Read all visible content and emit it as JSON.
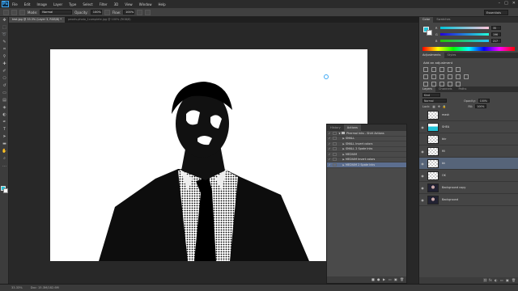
{
  "app": {
    "logo": "Ps"
  },
  "menu": [
    "File",
    "Edit",
    "Image",
    "Layer",
    "Type",
    "Select",
    "Filter",
    "3D",
    "View",
    "Window",
    "Help"
  ],
  "window_controls": [
    "–",
    "□",
    "✕"
  ],
  "options_bar": {
    "mode_label": "Mode:",
    "mode_value": "Normal",
    "opacity_label": "Opacity:",
    "opacity_value": "100%",
    "flow_label": "Flow:",
    "flow_value": "100%",
    "workspace": "Essentials"
  },
  "tabs": [
    "test.jpg @ 33.3% (Layer 3, RGB/8) *",
    "pexels-photo_1complete.jpg @ 100% (RGB/8)"
  ],
  "status": {
    "zoom": "33.33%",
    "doc": "Doc: 15.3M/182.6M"
  },
  "actions_panel": {
    "tabs": [
      "History",
      "Actions"
    ],
    "rows": [
      {
        "label": "Phermal Inks - Shirt Actions",
        "level": 0,
        "expanded": true
      },
      {
        "label": "SMALL",
        "level": 1
      },
      {
        "label": "SMALL Invert colors",
        "level": 1
      },
      {
        "label": "SMALL 2 Spate Inks",
        "level": 1
      },
      {
        "label": "MEDIUM",
        "level": 1
      },
      {
        "label": "MEDIUM Invert colors",
        "level": 1
      },
      {
        "label": "MEDIUM 2 Spate Inks",
        "level": 1,
        "selected": true
      }
    ],
    "footer_icons": [
      "■",
      "●",
      "▶",
      "▭",
      "▣",
      "🗑"
    ]
  },
  "color_panel": {
    "tabs": [
      "Color",
      "Swatches"
    ],
    "sliders": [
      {
        "label": "R",
        "value": "35"
      },
      {
        "label": "G",
        "value": "196"
      },
      {
        "label": "B",
        "value": "217"
      }
    ],
    "fg_color": "#23c4d9",
    "bg_color": "#ffffff"
  },
  "adjustments_panel": {
    "tabs": [
      "Adjustments",
      "Styles"
    ],
    "title": "Add an adjustment"
  },
  "layers_panel": {
    "tabs": [
      "Layers",
      "Channels",
      "Paths"
    ],
    "kind_label": "Kind",
    "blend_mode": "Normal",
    "opacity_label": "Opacity:",
    "opacity_value": "100%",
    "lock_label": "Lock:",
    "fill_label": "Fill:",
    "fill_value": "100%",
    "layers": [
      {
        "name": "mask",
        "thumb": "checker"
      },
      {
        "name": "SHEA",
        "thumb": "cyan"
      },
      {
        "name": "bkr",
        "thumb": "checker"
      },
      {
        "name": "fill",
        "thumb": "checker"
      },
      {
        "name": "bk",
        "thumb": "checker",
        "selected": true
      },
      {
        "name": "OK",
        "thumb": "checker"
      },
      {
        "name": "Background copy",
        "thumb": "photo"
      },
      {
        "name": "Background",
        "thumb": "photo"
      }
    ],
    "footer_icons": [
      "⛓",
      "fx",
      "◐",
      "▭",
      "▣",
      "🗑"
    ]
  }
}
